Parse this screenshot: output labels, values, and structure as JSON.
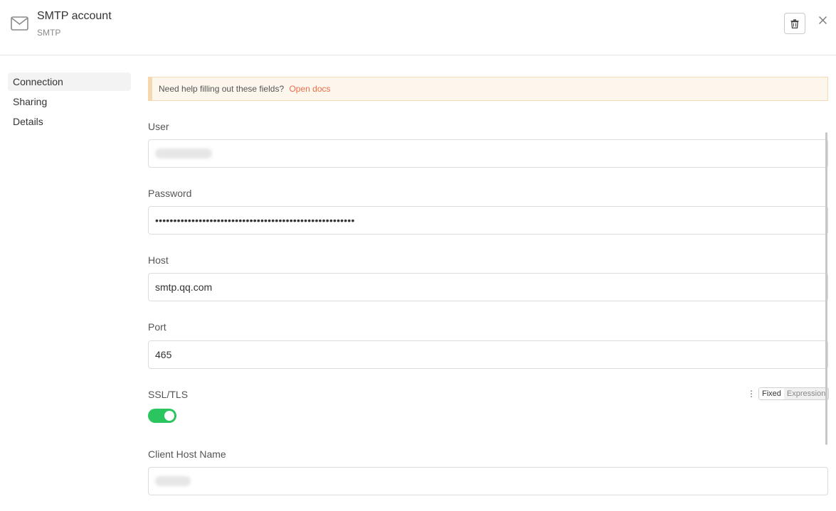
{
  "header": {
    "title": "SMTP account",
    "subtitle": "SMTP",
    "icon": "mail-icon"
  },
  "sidebar": {
    "items": [
      {
        "label": "Connection",
        "active": true
      },
      {
        "label": "Sharing",
        "active": false
      },
      {
        "label": "Details",
        "active": false
      }
    ]
  },
  "notice": {
    "text": "Need help filling out these fields?",
    "link": "Open docs"
  },
  "fields": {
    "user": {
      "label": "User",
      "value": ""
    },
    "password": {
      "label": "Password",
      "value": "•••••••••••••••••••••••••••••••••••••••••••••••••••••••"
    },
    "host": {
      "label": "Host",
      "value": "smtp.qq.com"
    },
    "port": {
      "label": "Port",
      "value": "465"
    },
    "ssl": {
      "label": "SSL/TLS",
      "enabled": true
    },
    "client_host": {
      "label": "Client Host Name",
      "value": ""
    }
  },
  "mode_switch": {
    "fixed": "Fixed",
    "expression": "Expression",
    "selected": "Fixed"
  },
  "colors": {
    "toggle_on": "#2bc55f",
    "link": "#ef6c4a",
    "notice_bg": "#fdf6ec"
  }
}
